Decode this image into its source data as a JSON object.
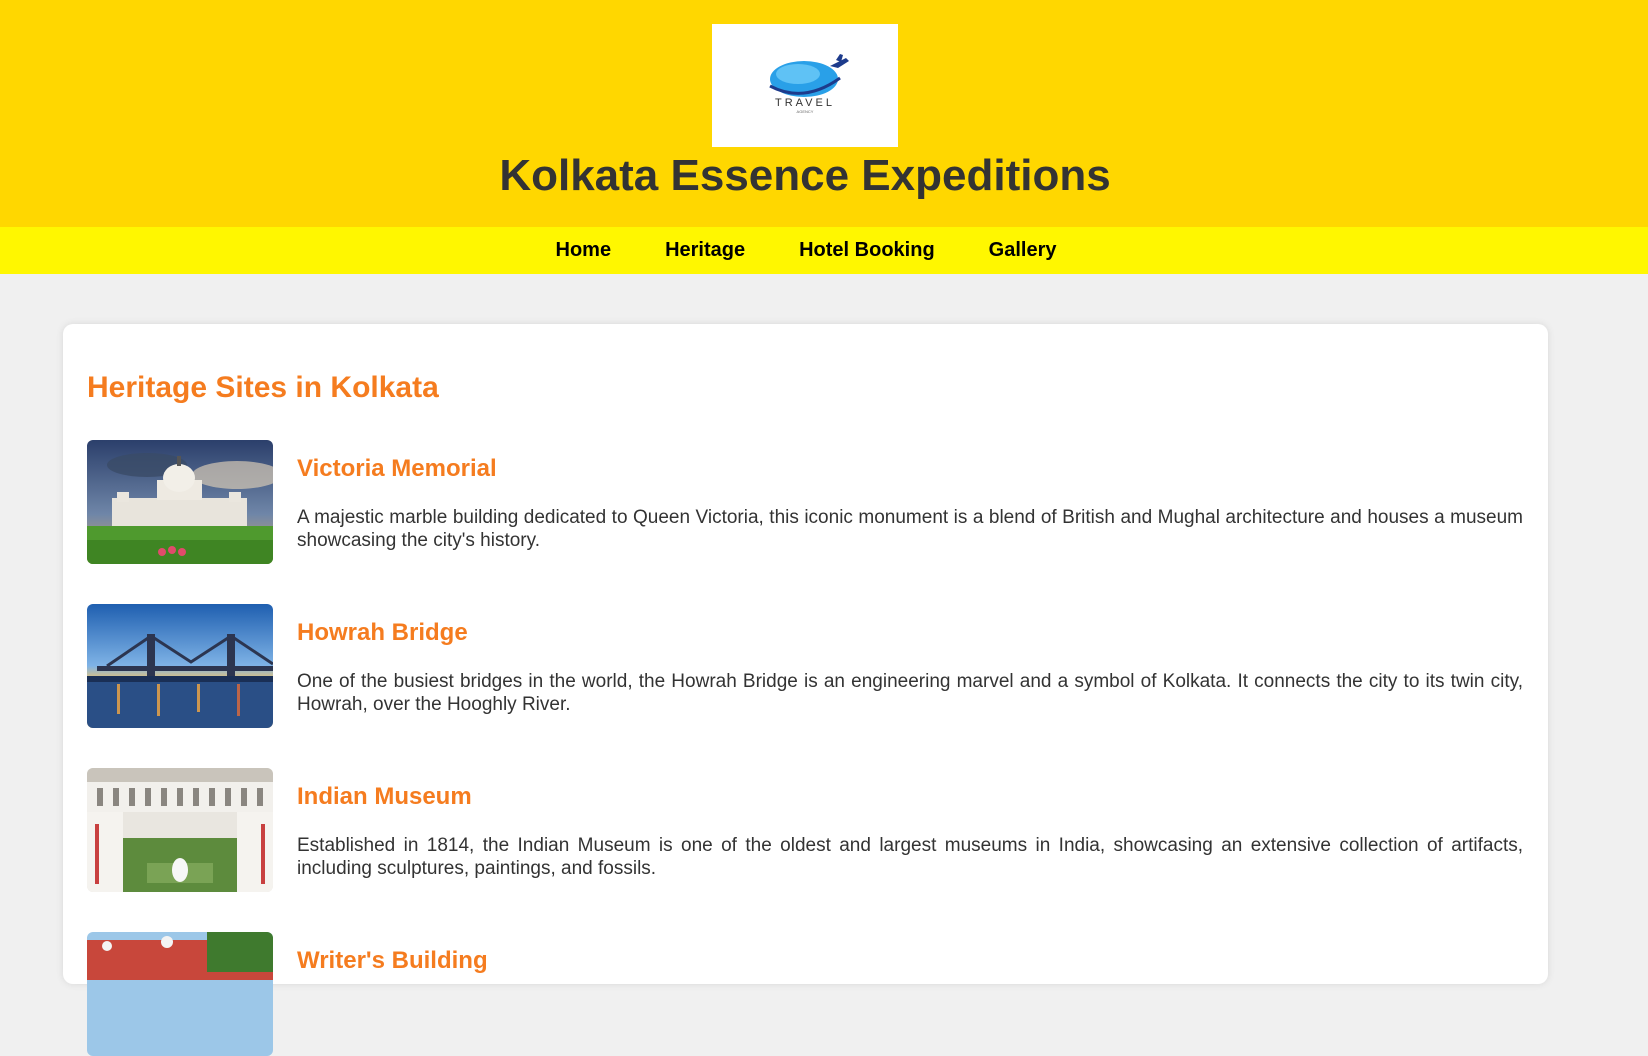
{
  "header": {
    "logo_text": "TRAVEL",
    "logo_subtext": "AGENCY",
    "title": "Kolkata Essence Expeditions"
  },
  "nav": {
    "items": [
      "Home",
      "Heritage",
      "Hotel Booking",
      "Gallery"
    ]
  },
  "main": {
    "section_title": "Heritage Sites in Kolkata",
    "sites": [
      {
        "name": "Victoria Memorial",
        "description": "A majestic marble building dedicated to Queen Victoria, this iconic monument is a blend of British and Mughal architecture and houses a museum showcasing the city's history.",
        "image_icon": "victoria-memorial-photo"
      },
      {
        "name": "Howrah Bridge",
        "description": "One of the busiest bridges in the world, the Howrah Bridge is an engineering marvel and a symbol of Kolkata. It connects the city to its twin city, Howrah, over the Hooghly River.",
        "image_icon": "howrah-bridge-photo"
      },
      {
        "name": "Indian Museum",
        "description": "Established in 1814, the Indian Museum is one of the oldest and largest museums in India, showcasing an extensive collection of artifacts, including sculptures, paintings, and fossils.",
        "image_icon": "indian-museum-photo"
      },
      {
        "name": "Writer's Building",
        "description": "",
        "image_icon": "writers-building-photo"
      }
    ]
  },
  "colors": {
    "header_bg": "#ffd700",
    "nav_bg": "#fff700",
    "accent": "#f57c1f",
    "page_bg": "#f0f0f0",
    "text": "#333333"
  }
}
